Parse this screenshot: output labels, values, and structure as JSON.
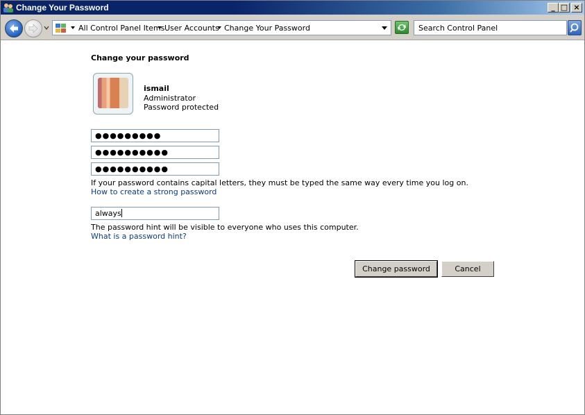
{
  "window": {
    "title": "Change Your Password",
    "buttons": {
      "minimize": "_",
      "maximize": "□",
      "close": "×"
    }
  },
  "toolbar": {
    "breadcrumbs": [
      "All Control Panel Items",
      "User Accounts",
      "Change Your Password"
    ],
    "search_placeholder": "Search Control Panel",
    "icons": [
      "back-arrow-icon",
      "forward-arrow-icon",
      "control-panel-icon",
      "refresh-icon",
      "search-icon"
    ]
  },
  "content": {
    "heading": "Change your password",
    "user": {
      "name": "ismail",
      "role": "Administrator",
      "status": "Password protected"
    },
    "fields": {
      "current_password_mask": "●●●●●●●●●",
      "new_password_mask": "●●●●●●●●●●",
      "confirm_password_mask": "●●●●●●●●●●",
      "hint_value": "always"
    },
    "notes": {
      "caps_warning": "If your password contains capital letters, they must be typed the same way every time you log on.",
      "strong_password_link": "How to create a strong password",
      "hint_warning": "The password hint will be visible to everyone who uses this computer.",
      "hint_link": "What is a password hint?"
    },
    "buttons": {
      "change": "Change password",
      "cancel": "Cancel"
    }
  },
  "colors": {
    "titlebar": "#0a246a",
    "link": "#0b3a8a",
    "button_face": "#d4d0c8"
  }
}
